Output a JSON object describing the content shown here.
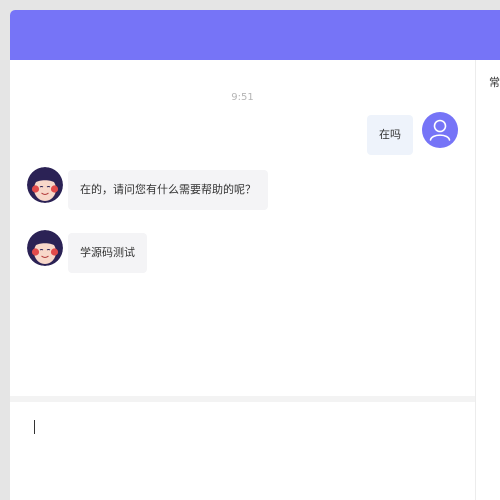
{
  "colors": {
    "accent": "#7674f7",
    "agent_bubble": "#f4f4f6",
    "user_bubble": "#eef3fb"
  },
  "chat": {
    "timestamp": "9:51",
    "messages": [
      {
        "sender": "user",
        "text": "在吗",
        "avatar": "user-avatar-icon"
      },
      {
        "sender": "agent",
        "text": "在的，请问您有什么需要帮助的呢？",
        "avatar": "agent-avatar"
      },
      {
        "sender": "agent",
        "text": "学源码测试",
        "avatar": "agent-avatar"
      }
    ]
  },
  "right_panel": {
    "title": "常"
  },
  "input": {
    "value": ""
  }
}
